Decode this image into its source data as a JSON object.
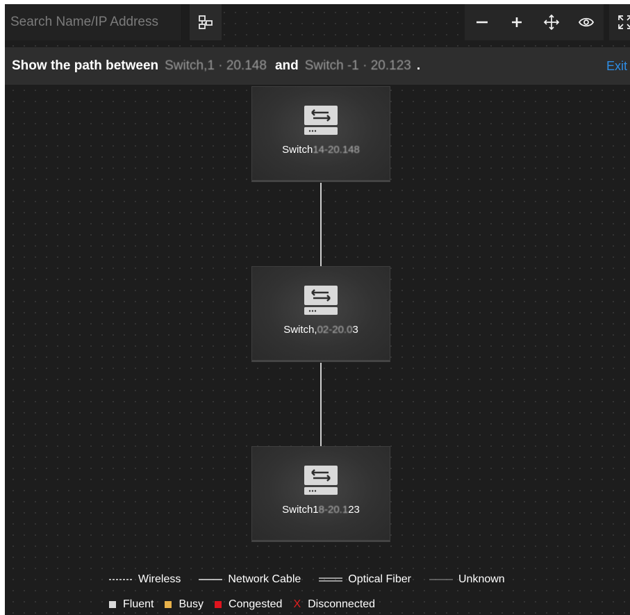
{
  "toolbar": {
    "search_placeholder": "Search Name/IP Address",
    "topology_icon": "topology-icon",
    "zoom_out_icon": "minus-icon",
    "zoom_in_icon": "plus-icon",
    "move_icon": "move-arrows-icon",
    "view_icon": "eye-icon",
    "fullscreen_icon": "fullscreen-icon"
  },
  "banner": {
    "prefix": "Show the path between",
    "device_a": "Switch,1 · 20.148",
    "conjunction": "and",
    "device_b": "Switch -1 · 20.123",
    "suffix": ".",
    "exit": "Exit"
  },
  "nodes": [
    {
      "name_prefix": "Switch",
      "name_blurred": "14-20.148",
      "name_suffix": "",
      "icon": "switch-icon"
    },
    {
      "name_prefix": "Switch,",
      "name_blurred": "02-20.0",
      "name_suffix": "3",
      "icon": "switch-icon"
    },
    {
      "name_prefix": "Switch1",
      "name_blurred": "8-20.1",
      "name_suffix": "23",
      "icon": "switch-icon"
    }
  ],
  "legend": {
    "lines": [
      {
        "label": "Wireless",
        "style": "dashed"
      },
      {
        "label": "Network Cable",
        "style": "solid"
      },
      {
        "label": "Optical Fiber",
        "style": "double"
      },
      {
        "label": "Unknown",
        "style": "thin"
      }
    ],
    "statuses": [
      {
        "label": "Fluent",
        "color": "#d9d9d9"
      },
      {
        "label": "Busy",
        "color": "#e8b24a"
      },
      {
        "label": "Congested",
        "color": "#e0141e"
      },
      {
        "label": "Disconnected",
        "color": "#e02020",
        "mark": "X"
      }
    ]
  },
  "colors": {
    "canvas": "#1d1d1d",
    "banner": "#2e2e2e",
    "exit_link": "#2e8ee6",
    "link_line": "#cfcfcf"
  }
}
